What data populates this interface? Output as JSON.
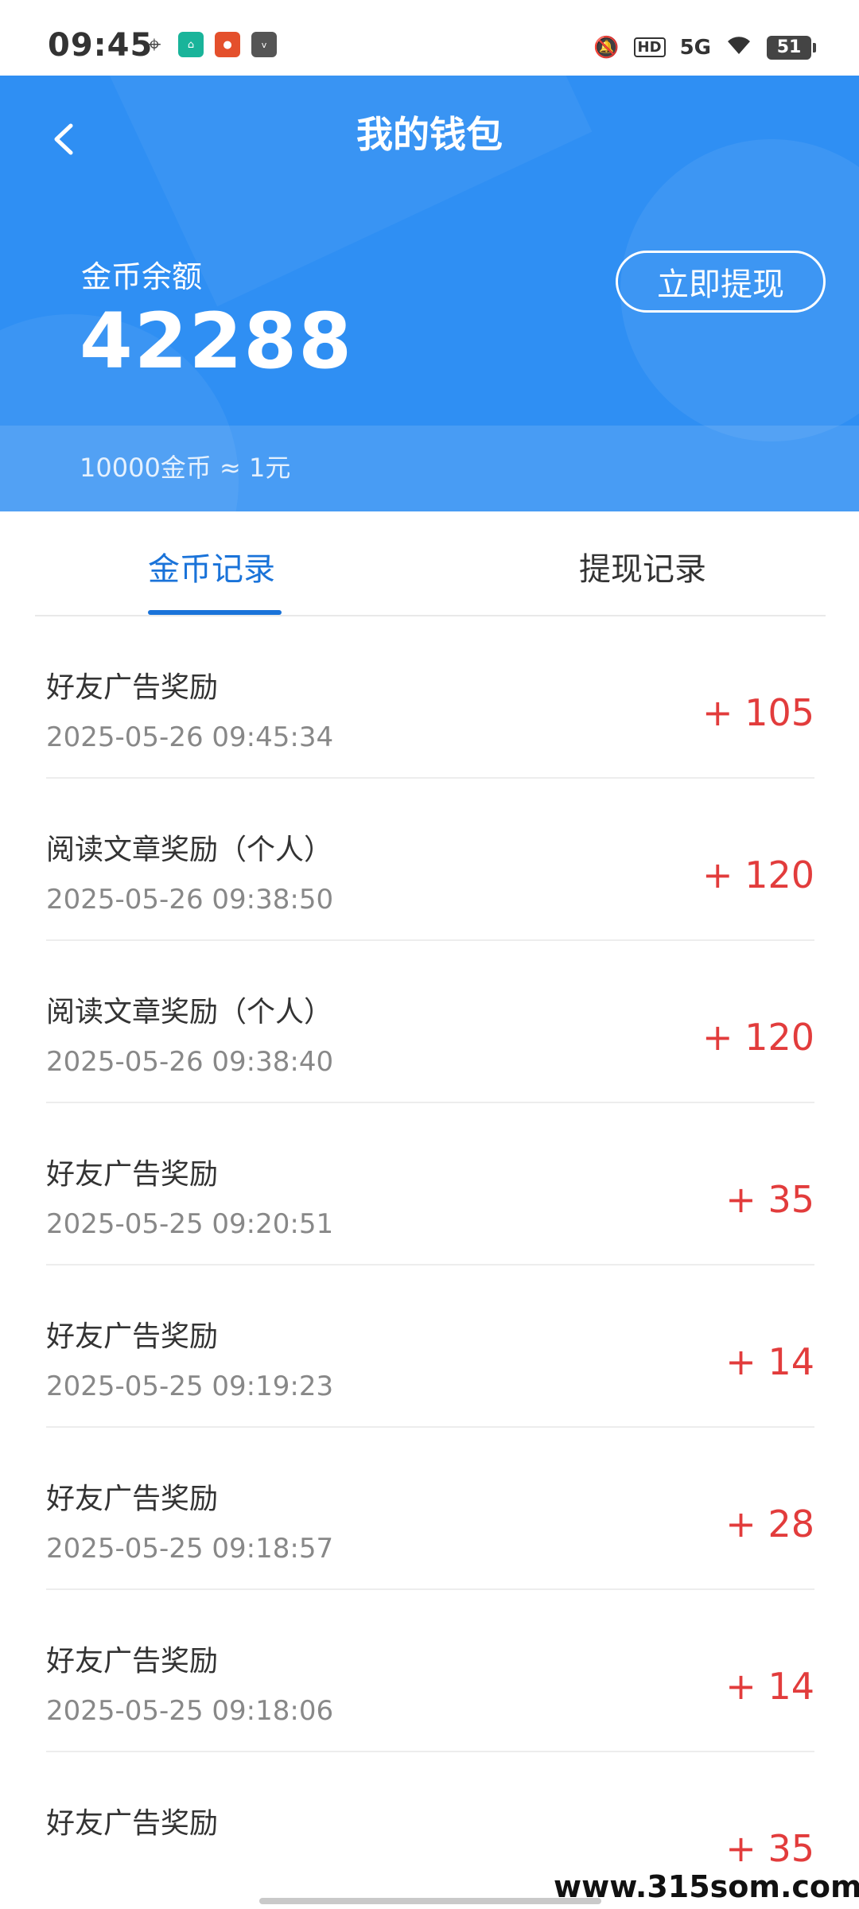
{
  "status_bar": {
    "time": "09:45",
    "network": "5G",
    "hd": "HD",
    "battery": "51"
  },
  "header": {
    "title": "我的钱包",
    "balance_label": "金币余额",
    "balance_value": "42288",
    "withdraw_button": "立即提现",
    "rate_text": "10000金币 ≈ 1元"
  },
  "tabs": [
    {
      "label": "金币记录",
      "active": true
    },
    {
      "label": "提现记录",
      "active": false
    }
  ],
  "records": [
    {
      "title": "好友广告奖励",
      "time": "2025-05-26 09:45:34",
      "amount": "+ 105"
    },
    {
      "title": "阅读文章奖励（个人）",
      "time": "2025-05-26 09:38:50",
      "amount": "+ 120"
    },
    {
      "title": "阅读文章奖励（个人）",
      "time": "2025-05-26 09:38:40",
      "amount": "+ 120"
    },
    {
      "title": "好友广告奖励",
      "time": "2025-05-25 09:20:51",
      "amount": "+ 35"
    },
    {
      "title": "好友广告奖励",
      "time": "2025-05-25 09:19:23",
      "amount": "+ 14"
    },
    {
      "title": "好友广告奖励",
      "time": "2025-05-25 09:18:57",
      "amount": "+ 28"
    },
    {
      "title": "好友广告奖励",
      "time": "2025-05-25 09:18:06",
      "amount": "+ 14"
    },
    {
      "title": "好友广告奖励",
      "time": "",
      "amount": "+ 35"
    }
  ],
  "watermark": "www.315som.com",
  "colors": {
    "header_bg": "#2f8ff3",
    "active_tab": "#1a73d9",
    "amount": "#e23c3c"
  }
}
